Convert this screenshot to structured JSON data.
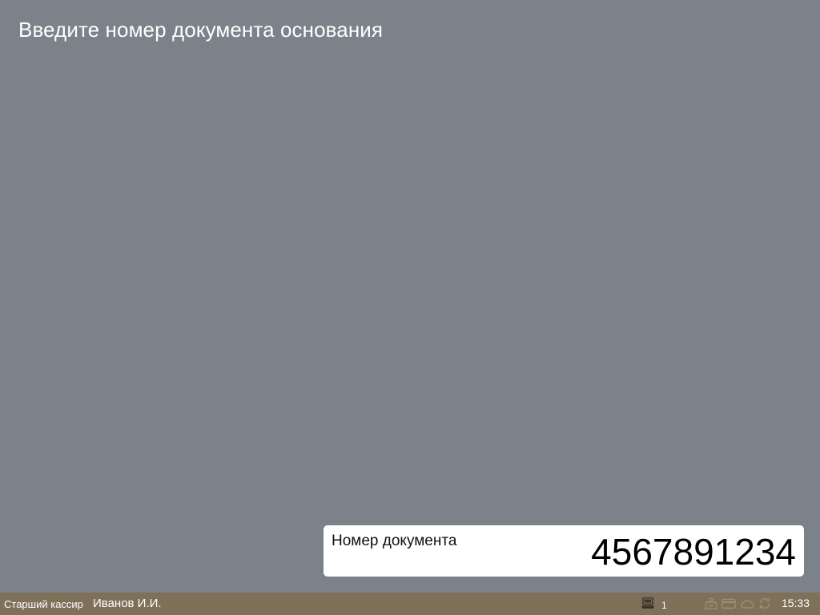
{
  "header": {
    "title": "Введите номер документа основания"
  },
  "document_input": {
    "label": "Номер документа",
    "value": "4567891234"
  },
  "statusbar": {
    "role": "Старший кассир",
    "user": "Иванов И.И.",
    "terminal_icon": "terminal-icon",
    "terminal_number": "1",
    "status_icons": [
      "scales-icon",
      "card-icon",
      "cloud-icon",
      "sync-icon"
    ],
    "time": "15:33"
  },
  "colors": {
    "background": "#7b828a",
    "statusbar": "#7f7059",
    "panel": "#ffffff",
    "icon_dim": "#9c8d73"
  }
}
